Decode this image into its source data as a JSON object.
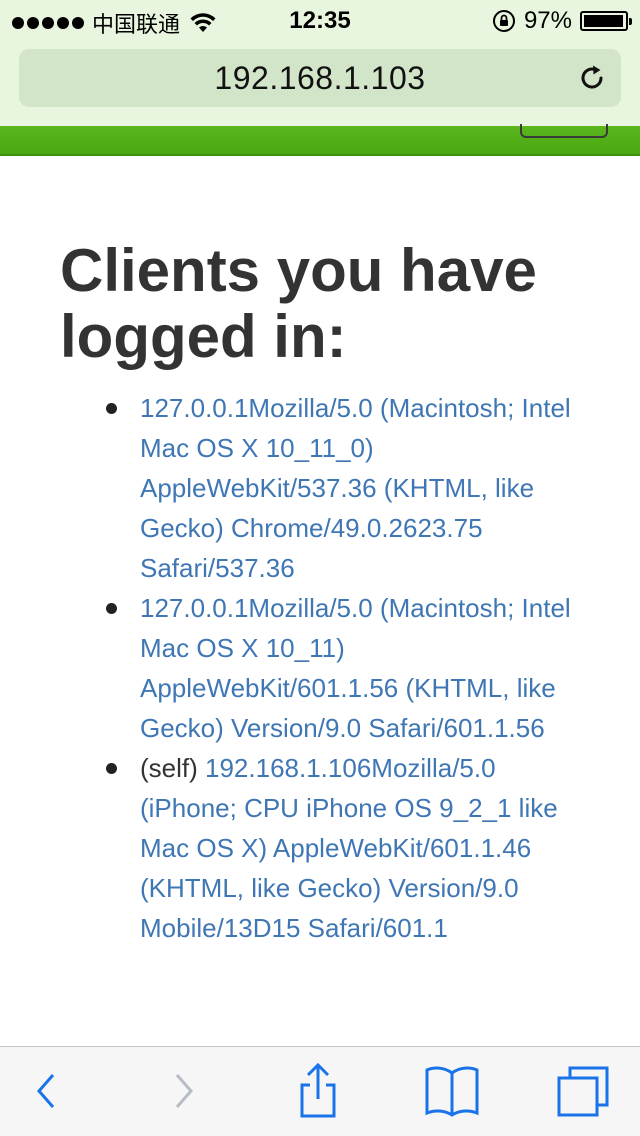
{
  "status_bar": {
    "carrier": "中国联通",
    "time": "12:35",
    "battery_percent": "97%",
    "battery_level": 0.97,
    "signal_bars": 5
  },
  "address_bar": {
    "url": "192.168.1.103"
  },
  "page": {
    "heading": "Clients you have logged in:",
    "clients": [
      {
        "prefix": "",
        "text": "127.0.0.1Mozilla/5.0 (Macintosh; Intel Mac OS X 10_11_0) AppleWebKit/537.36 (KHTML, like Gecko) Chrome/49.0.2623.75 Safari/537.36"
      },
      {
        "prefix": "",
        "text": "127.0.0.1Mozilla/5.0 (Macintosh; Intel Mac OS X 10_11) AppleWebKit/601.1.56 (KHTML, like Gecko) Version/9.0 Safari/601.1.56"
      },
      {
        "prefix": "(self)",
        "text": "192.168.1.106Mozilla/5.0 (iPhone; CPU iPhone OS 9_2_1 like Mac OS X) AppleWebKit/601.1.46 (KHTML, like Gecko) Version/9.0 Mobile/13D15 Safari/601.1"
      }
    ]
  },
  "colors": {
    "link": "#3f76b4",
    "nav_green": "#52b017",
    "chrome_bg": "#e9f6df",
    "url_field_bg": "#d3e5c8",
    "toolbar_icon": "#1a73e8",
    "toolbar_icon_disabled": "#b8bcc4"
  },
  "toolbar": {
    "icons": [
      "back-icon",
      "forward-icon",
      "share-icon",
      "bookmarks-icon",
      "tabs-icon"
    ]
  }
}
